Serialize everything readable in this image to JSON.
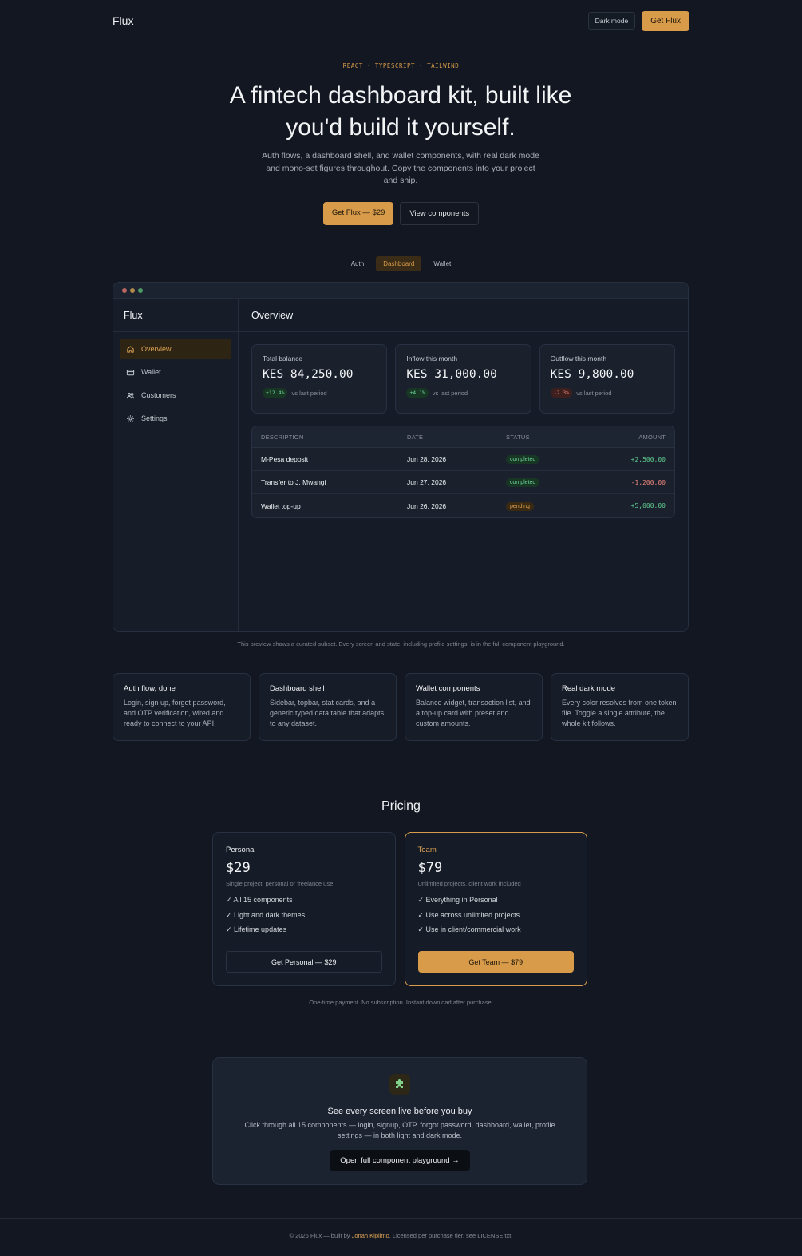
{
  "header": {
    "logo": "Flux",
    "dark_mode_label": "Dark mode",
    "cta_label": "Get Flux"
  },
  "hero": {
    "eyebrow": "REACT · TYPESCRIPT · TAILWIND",
    "title": "A fintech dashboard kit, built like you'd build it yourself.",
    "subtitle": "Auth flows, a dashboard shell, and wallet components, with real dark mode and mono-set figures throughout. Copy the components into your project and ship.",
    "primary_cta": "Get Flux — $29",
    "secondary_cta": "View components"
  },
  "preview_tabs": [
    "Auth",
    "Dashboard",
    "Wallet"
  ],
  "preview_active_tab": "Dashboard",
  "app": {
    "logo": "Flux",
    "nav": [
      {
        "label": "Overview",
        "icon": "home-icon",
        "active": true
      },
      {
        "label": "Wallet",
        "icon": "wallet-icon",
        "active": false
      },
      {
        "label": "Customers",
        "icon": "users-icon",
        "active": false
      },
      {
        "label": "Settings",
        "icon": "gear-icon",
        "active": false
      }
    ],
    "page_title": "Overview",
    "stats": [
      {
        "label": "Total balance",
        "value": "KES 84,250.00",
        "change": "+12.4%",
        "direction": "up",
        "note": "vs last period"
      },
      {
        "label": "Inflow this month",
        "value": "KES 31,000.00",
        "change": "+4.1%",
        "direction": "up",
        "note": "vs last period"
      },
      {
        "label": "Outflow this month",
        "value": "KES 9,800.00",
        "change": "-2.3%",
        "direction": "down",
        "note": "vs last period"
      }
    ],
    "table": {
      "columns": [
        "DESCRIPTION",
        "DATE",
        "STATUS",
        "AMOUNT"
      ],
      "rows": [
        {
          "description": "M-Pesa deposit",
          "date": "Jun 28, 2026",
          "status": "completed",
          "amount": "+2,500.00"
        },
        {
          "description": "Transfer to J. Mwangi",
          "date": "Jun 27, 2026",
          "status": "completed",
          "amount": "-1,200.00"
        },
        {
          "description": "Wallet top-up",
          "date": "Jun 26, 2026",
          "status": "pending",
          "amount": "+5,000.00"
        }
      ]
    }
  },
  "preview_caption": "This preview shows a curated subset. Every screen and state, including profile settings, is in the full component playground.",
  "features": [
    {
      "title": "Auth flow, done",
      "body": "Login, sign up, forgot password, and OTP verification, wired and ready to connect to your API."
    },
    {
      "title": "Dashboard shell",
      "body": "Sidebar, topbar, stat cards, and a generic typed data table that adapts to any dataset."
    },
    {
      "title": "Wallet components",
      "body": "Balance widget, transaction list, and a top-up card with preset and custom amounts."
    },
    {
      "title": "Real dark mode",
      "body": "Every color resolves from one token file. Toggle a single attribute, the whole kit follows."
    }
  ],
  "pricing": {
    "title": "Pricing",
    "plans": [
      {
        "name": "Personal",
        "price": "$29",
        "description": "Single project, personal or freelance use",
        "features": [
          "✓ All 15 components",
          "✓ Light and dark themes",
          "✓ Lifetime updates"
        ],
        "cta": "Get Personal — $29",
        "featured": false
      },
      {
        "name": "Team",
        "price": "$79",
        "description": "Unlimited projects, client work included",
        "features": [
          "✓ Everything in Personal",
          "✓ Use across unlimited projects",
          "✓ Use in client/commercial work"
        ],
        "cta": "Get Team — $79",
        "featured": true
      }
    ],
    "note": "One-time payment. No subscription. Instant download after purchase."
  },
  "playground": {
    "icon": "puzzle-icon",
    "title": "See every screen live before you buy",
    "subtitle": "Click through all 15 components — login, signup, OTP, forgot password, dashboard, wallet, profile settings — in both light and dark mode.",
    "cta": "Open full component playground →"
  },
  "footer": {
    "prefix": "© 2026 Flux — built by",
    "author": "Jonah Kiplimo",
    "suffix": ". Licensed per purchase tier, see LICENSE.txt."
  },
  "colors": {
    "accent": "#d89b4a",
    "background": "#121721",
    "success": "#6fd59a",
    "danger": "#e8837a"
  }
}
